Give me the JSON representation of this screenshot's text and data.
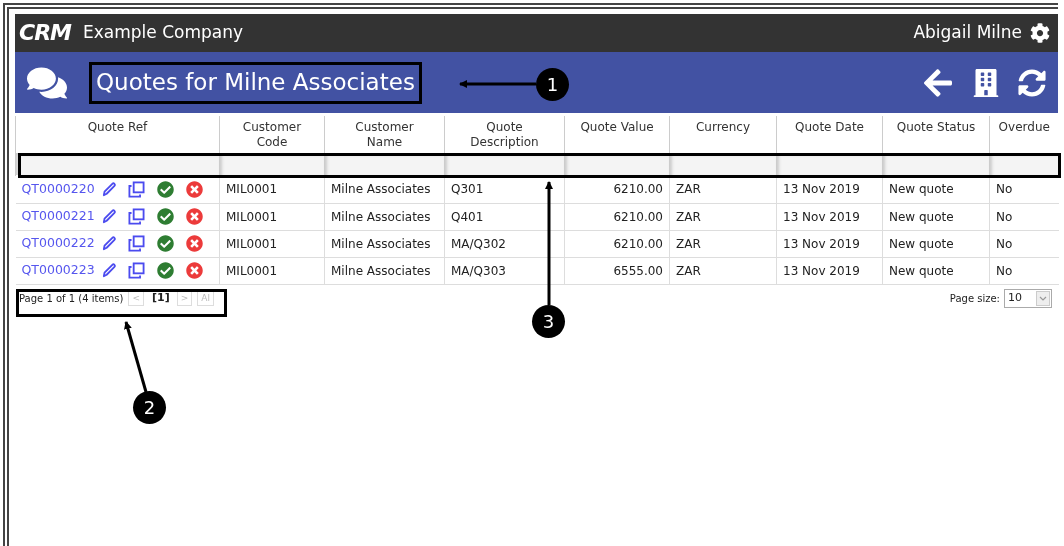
{
  "top_bar": {
    "logo": "CRM",
    "company": "Example Company",
    "user": "Abigail Milne"
  },
  "title_bar": {
    "title": "Quotes for Milne Associates"
  },
  "table": {
    "columns": [
      {
        "label": "Quote Ref",
        "kind": "text"
      },
      {
        "label": "Customer\nCode",
        "kind": "text"
      },
      {
        "label": "Customer\nName",
        "kind": "text"
      },
      {
        "label": "Quote\nDescription",
        "kind": "text"
      },
      {
        "label": "Quote Value",
        "kind": "number"
      },
      {
        "label": "Currency",
        "kind": "text"
      },
      {
        "label": "Quote Date",
        "kind": "text"
      },
      {
        "label": "Quote Status",
        "kind": "text"
      },
      {
        "label": "Overdue",
        "kind": "text"
      }
    ],
    "rows": [
      {
        "cells": [
          "QT0000220",
          "MIL0001",
          "Milne Associates",
          "Q301",
          "6210.00",
          "ZAR",
          "13 Nov 2019",
          "New quote",
          "No"
        ]
      },
      {
        "cells": [
          "QT0000221",
          "MIL0001",
          "Milne Associates",
          "Q401",
          "6210.00",
          "ZAR",
          "13 Nov 2019",
          "New quote",
          "No"
        ]
      },
      {
        "cells": [
          "QT0000222",
          "MIL0001",
          "Milne Associates",
          "MA/Q302",
          "6210.00",
          "ZAR",
          "13 Nov 2019",
          "New quote",
          "No"
        ]
      },
      {
        "cells": [
          "QT0000223",
          "MIL0001",
          "Milne Associates",
          "MA/Q303",
          "6555.00",
          "ZAR",
          "13 Nov 2019",
          "New quote",
          "No"
        ]
      }
    ]
  },
  "pager": {
    "summary": "Page 1 of 1 (4 items)",
    "buttons": [
      {
        "label": "<",
        "kind": "nav",
        "disabled": true
      },
      {
        "label": "[1]",
        "kind": "page",
        "disabled": false
      },
      {
        "label": ">",
        "kind": "nav",
        "disabled": true
      },
      {
        "label": "Al",
        "kind": "nav",
        "disabled": true
      }
    ],
    "page_size_label": "Page size:",
    "page_size": "10"
  },
  "callouts": [
    {
      "number": "1"
    },
    {
      "number": "2"
    },
    {
      "number": "3"
    }
  ]
}
